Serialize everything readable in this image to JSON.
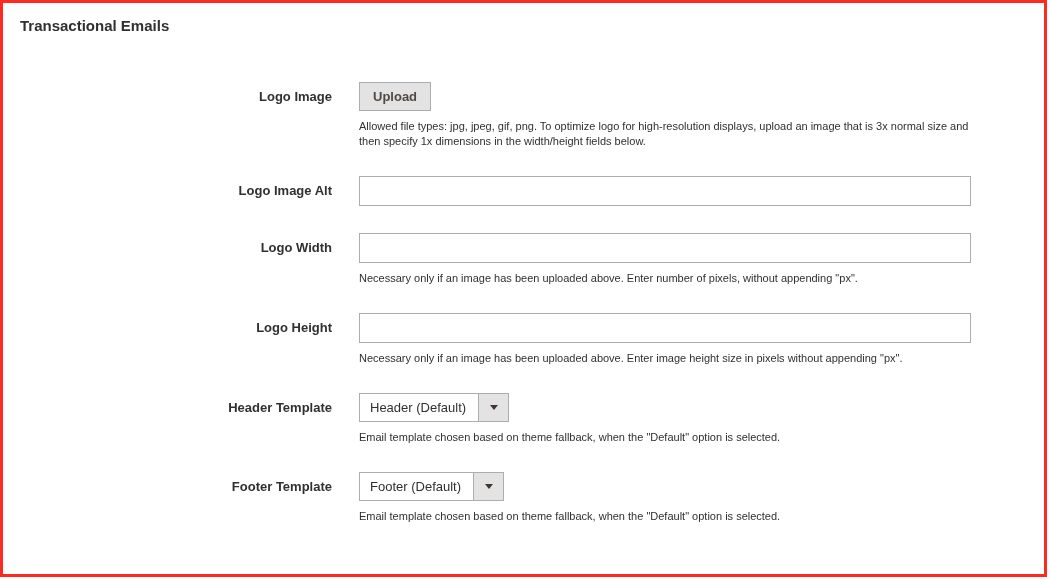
{
  "section": {
    "title": "Transactional Emails"
  },
  "fields": [
    {
      "kind": "upload",
      "label": "Logo Image",
      "button": "Upload",
      "note": "Allowed file types: jpg, jpeg, gif, png. To optimize logo for high-resolution displays, upload an image that is 3x normal size and then specify 1x dimensions in the width/height fields below."
    },
    {
      "kind": "text",
      "label": "Logo Image Alt"
    },
    {
      "kind": "text",
      "label": "Logo Width",
      "note": "Necessary only if an image has been uploaded above. Enter number of pixels, without appending \"px\"."
    },
    {
      "kind": "text",
      "label": "Logo Height",
      "note": "Necessary only if an image has been uploaded above. Enter image height size in pixels without appending \"px\"."
    },
    {
      "kind": "select",
      "label": "Header Template",
      "value": "Header (Default)",
      "note": "Email template chosen based on theme fallback, when the \"Default\" option is selected."
    },
    {
      "kind": "select",
      "label": "Footer Template",
      "value": "Footer (Default)",
      "note": "Email template chosen based on theme fallback, when the \"Default\" option is selected."
    }
  ]
}
